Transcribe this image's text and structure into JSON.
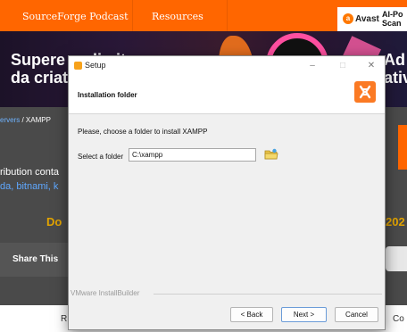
{
  "website": {
    "nav": {
      "podcast": "SourceForge Podcast",
      "resources": "Resources"
    },
    "ad": {
      "brand": "Avast",
      "headline_line1": "AI-Po",
      "headline_line2": "Scan"
    },
    "banner": {
      "title_line1": "Supere os limites",
      "title_line2": "da criat",
      "right_line1": "Ad",
      "right_line2": "ativ"
    },
    "breadcrumb": {
      "prev": "ervers",
      "separator": " / ",
      "current": "XAMPP"
    },
    "distribution": {
      "text": "ribution conta",
      "links": "da, bitnami, k"
    },
    "download_partial": "Do",
    "year_partial": "202",
    "share_label": "Share This",
    "footer": {
      "left": "R",
      "right": "Co"
    },
    "accent_color": "#ff6600"
  },
  "dialog": {
    "title": "Setup",
    "window_buttons": {
      "minimize": "–",
      "maximize": "□",
      "close": "✕"
    },
    "header_title": "Installation folder",
    "instruction": "Please, choose a folder to install XAMPP",
    "folder_label": "Select a folder",
    "folder_value": "C:\\xampp",
    "footer_label": "VMware InstallBuilder",
    "buttons": {
      "back": "< Back",
      "next": "Next >",
      "cancel": "Cancel"
    },
    "icons": {
      "app": "xampp-icon",
      "browse": "folder-icon"
    }
  }
}
